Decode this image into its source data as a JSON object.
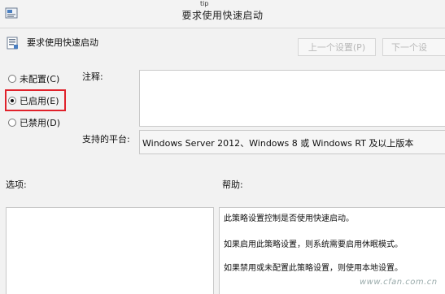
{
  "window": {
    "title": "要求使用快速启动",
    "top_mark": "tip"
  },
  "policy": {
    "name": "要求使用快速启动"
  },
  "nav": {
    "prev_label": "上一个设置(P)",
    "next_label": "下一个设"
  },
  "options": {
    "not_configured": "未配置(C)",
    "enabled": "已启用(E)",
    "disabled": "已禁用(D)",
    "selected": "enabled"
  },
  "labels": {
    "comment": "注释:",
    "supported_on": "支持的平台:",
    "options": "选项:",
    "help": "帮助:"
  },
  "comment_value": "",
  "supported_on_value": "Windows Server 2012、Windows 8 或 Windows RT 及以上版本",
  "help_lines": [
    "此策略设置控制是否使用快速启动。",
    "如果启用此策略设置，则系统需要启用休眠模式。",
    "如果禁用或未配置此策略设置，则使用本地设置。"
  ],
  "watermark": "www.cfan.com.cn",
  "colors": {
    "highlight_border": "#e0222b",
    "panel_bg": "#f2f2f2",
    "disabled_text": "#b8b8b8"
  },
  "icons": {
    "app": "policy-window-icon",
    "policy": "policy-setting-icon"
  }
}
